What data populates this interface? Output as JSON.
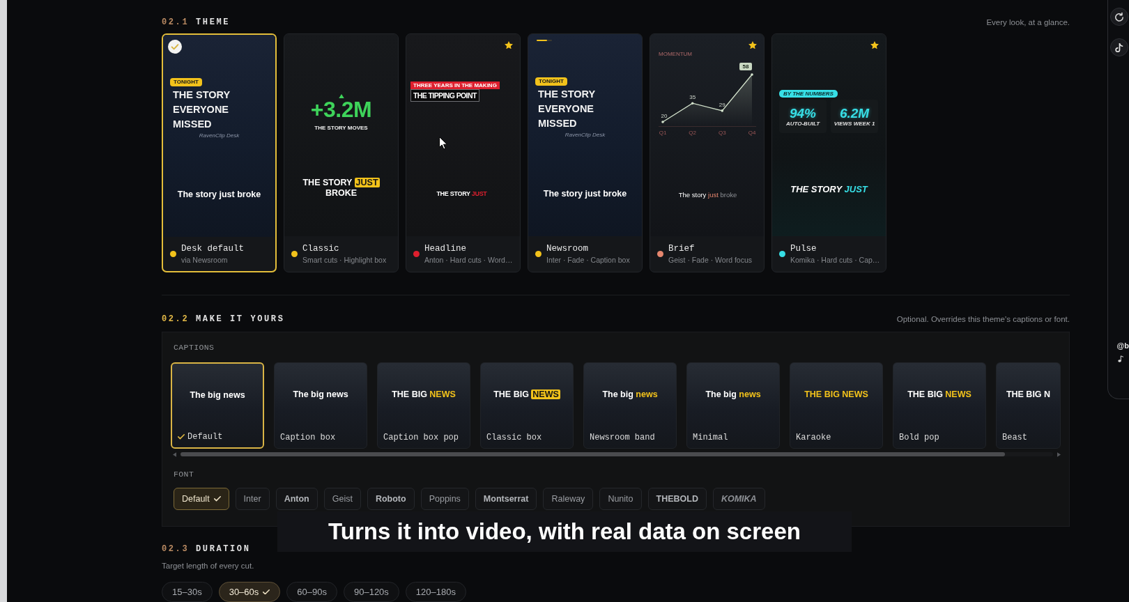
{
  "theme": {
    "number": "02.1",
    "title": "THEME",
    "active": false,
    "note": "Every look, at a glance.",
    "cards": [
      {
        "name": "Desk default",
        "detail": "via Newsroom",
        "color": "#f2c21b",
        "selected": true,
        "starred": false,
        "preview": {
          "kind": "story",
          "badge": "TONIGHT",
          "headline": "THE STORY EVERYONE MISSED",
          "credit": "RavenClip Desk",
          "caption": [
            {
              "text": "The story just broke",
              "kind": "plain"
            }
          ]
        }
      },
      {
        "name": "Classic",
        "detail": "Smart cuts · Highlight box",
        "color": "#f2c21b",
        "selected": false,
        "starred": false,
        "preview": {
          "kind": "stat",
          "figure": "+3.2M",
          "figure_label": "THE STORY MOVES",
          "caption": [
            {
              "text": "THE STORY",
              "kind": "plain"
            },
            {
              "text": "JUST",
              "kind": "box"
            },
            {
              "text": "BROKE",
              "kind": "plain"
            }
          ]
        }
      },
      {
        "name": "Headline",
        "detail": "Anton · Hard cuts · Word…",
        "color": "#de1f2e",
        "selected": false,
        "starred": true,
        "preview": {
          "kind": "headline",
          "kicker": "THREE YEARS IN THE MAKING",
          "headline": "THE TIPPING POINT",
          "caption": [
            {
              "text": "THE STORY",
              "kind": "plain"
            },
            {
              "text": "JUST",
              "kind": "color"
            }
          ]
        }
      },
      {
        "name": "Newsroom",
        "detail": "Inter · Fade · Caption box",
        "color": "#f2c21b",
        "selected": false,
        "starred": false,
        "preview": {
          "kind": "story",
          "progress": {
            "level": 0.7
          },
          "badge": "TONIGHT",
          "headline": "THE STORY EVERYONE MISSED",
          "credit": "RavenClip Desk",
          "caption": [
            {
              "text": "The story just broke",
              "kind": "plain"
            }
          ]
        }
      },
      {
        "name": "Brief",
        "detail": "Geist · Fade · Word focus",
        "color": "#e5866e",
        "selected": false,
        "starred": true,
        "preview": {
          "kind": "chart",
          "chart_data": {
            "type": "area",
            "title": "MOMENTUM",
            "categories": [
              "Q1",
              "Q2",
              "Q3",
              "Q4"
            ],
            "series": [
              {
                "color": "#d3e2cc",
                "values": [
                  20,
                  35,
                  29,
                  58
                ]
              }
            ],
            "data_labels": true
          },
          "caption": [
            {
              "text": "The story",
              "kind": "plain"
            },
            {
              "text": "just",
              "kind": "color"
            },
            {
              "text": "broke",
              "kind": "dim"
            }
          ]
        }
      },
      {
        "name": "Pulse",
        "detail": "Komika · Hard cuts · Cap…",
        "color": "#37dfe6",
        "selected": false,
        "starred": true,
        "preview": {
          "kind": "numbers",
          "badge": "BY THE NUMBERS",
          "stats": [
            {
              "value": "94%",
              "label": "AUTO-BUILT"
            },
            {
              "value": "6.2M",
              "label": "VIEWS WEEK 1"
            }
          ],
          "caption": [
            {
              "text": "THE STORY",
              "kind": "plain"
            },
            {
              "text": "JUST",
              "kind": "color"
            }
          ]
        }
      }
    ]
  },
  "make_it_yours": {
    "number": "02.2",
    "title": "MAKE IT YOURS",
    "active": true,
    "note": "Optional. Overrides this theme's captions or font.",
    "captions_label": "CAPTIONS",
    "captions": [
      {
        "name": "Default",
        "selected": true,
        "words": [
          {
            "text": "The big news",
            "kind": "plain"
          }
        ]
      },
      {
        "name": "Caption box",
        "selected": false,
        "words": [
          {
            "text": "The big news",
            "kind": "plain"
          }
        ]
      },
      {
        "name": "Caption box pop",
        "selected": false,
        "words": [
          {
            "text": "THE BIG",
            "kind": "plain"
          },
          {
            "text": "NEWS",
            "kind": "color"
          }
        ]
      },
      {
        "name": "Classic box",
        "selected": false,
        "words": [
          {
            "text": "THE BIG",
            "kind": "plain"
          },
          {
            "text": "NEWS",
            "kind": "box"
          }
        ]
      },
      {
        "name": "Newsroom band",
        "selected": false,
        "words": [
          {
            "text": "The big",
            "kind": "plain"
          },
          {
            "text": "news",
            "kind": "color"
          }
        ]
      },
      {
        "name": "Minimal",
        "selected": false,
        "words": [
          {
            "text": "The big",
            "kind": "plain"
          },
          {
            "text": "news",
            "kind": "color"
          }
        ]
      },
      {
        "name": "Karaoke",
        "selected": false,
        "words": [
          {
            "text": "THE BIG NEWS",
            "kind": "color"
          }
        ]
      },
      {
        "name": "Bold pop",
        "selected": false,
        "words": [
          {
            "text": "THE BIG",
            "kind": "plain"
          },
          {
            "text": "NEWS",
            "kind": "color"
          }
        ]
      },
      {
        "name": "Beast",
        "selected": false,
        "words": [
          {
            "text": "THE BIG N",
            "kind": "plain"
          }
        ]
      }
    ],
    "font_label": "FONT",
    "fonts": [
      {
        "name": "Default",
        "kind": "plain",
        "selected": true
      },
      {
        "name": "Inter",
        "kind": "plain",
        "selected": false
      },
      {
        "name": "Anton",
        "kind": "heavy",
        "selected": false
      },
      {
        "name": "Geist",
        "kind": "plain",
        "selected": false
      },
      {
        "name": "Roboto",
        "kind": "heavy",
        "selected": false
      },
      {
        "name": "Poppins",
        "kind": "plain",
        "selected": false
      },
      {
        "name": "Montserrat",
        "kind": "heavy",
        "selected": false
      },
      {
        "name": "Raleway",
        "kind": "plain",
        "selected": false
      },
      {
        "name": "Nunito",
        "kind": "plain",
        "selected": false
      },
      {
        "name": "THEBOLD",
        "kind": "heavy",
        "selected": false
      },
      {
        "name": "KOMIKA",
        "kind": "italic",
        "selected": false
      }
    ]
  },
  "duration": {
    "number": "02.3",
    "title": "DURATION",
    "active": false,
    "note": "Target length of every cut.",
    "options": [
      {
        "label": "15–30s",
        "selected": false
      },
      {
        "label": "30–60s",
        "selected": true
      },
      {
        "label": "60–90s",
        "selected": false
      },
      {
        "label": "90–120s",
        "selected": false
      },
      {
        "label": "120–180s",
        "selected": false
      }
    ]
  },
  "subtitle": "Turns it into video, with real data on screen",
  "phone_preview": {
    "handle": "@b"
  }
}
